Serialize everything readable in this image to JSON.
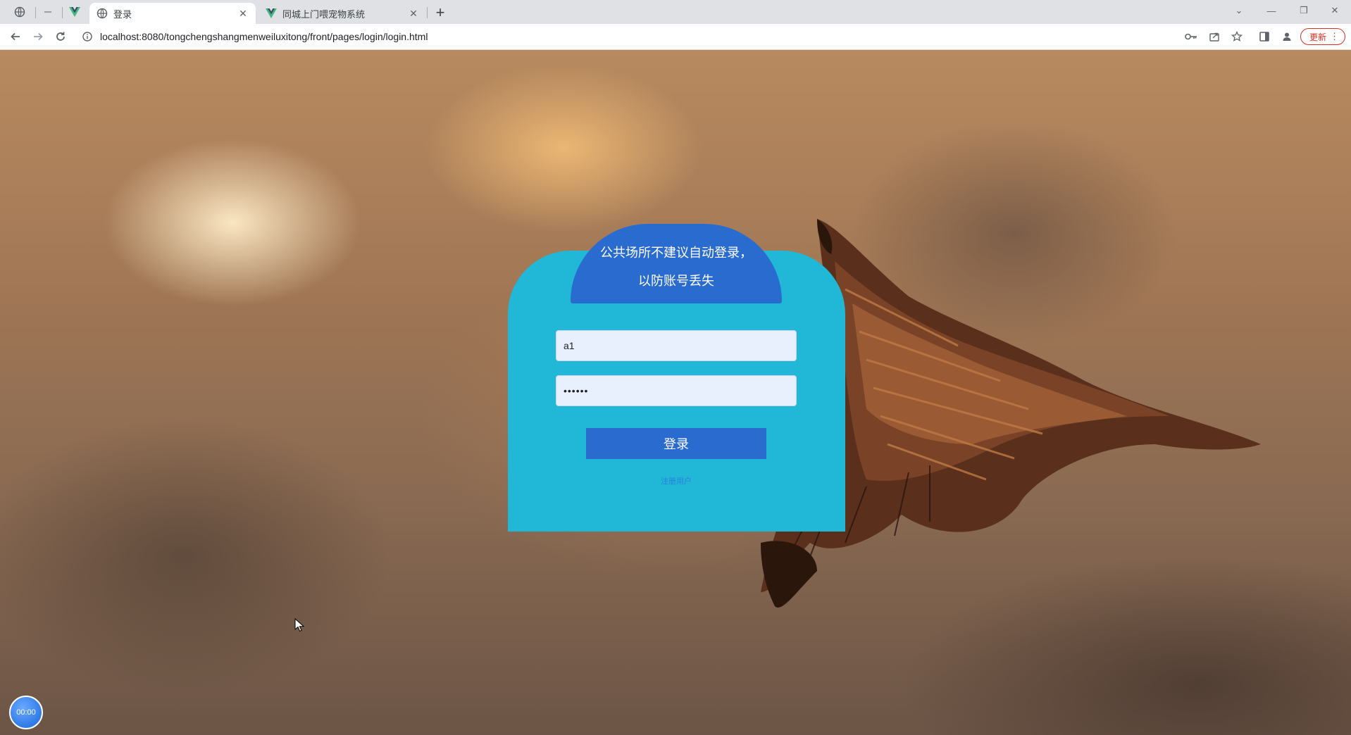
{
  "browser": {
    "tabs": [
      {
        "title": "登录",
        "active": true
      },
      {
        "title": "同城上门喂宠物系统",
        "active": false
      }
    ],
    "address_url": "localhost:8080/tongchengshangmenweiluxitong/front/pages/login/login.html",
    "update_label": "更新",
    "icons": {
      "back": "arrow-left-icon",
      "forward": "arrow-right-icon",
      "reload": "reload-icon",
      "info": "info-icon",
      "key": "key-icon",
      "share": "share-icon",
      "star": "star-icon",
      "sidepanel": "side-panel-icon",
      "profile": "profile-icon"
    }
  },
  "login": {
    "header_text": "公共场所不建议自动登录，以防账号丢失",
    "username_value": "a1",
    "password_value": "••••••",
    "submit_label": "登录",
    "register_link": "注册用户"
  },
  "floater_label": "00:00",
  "colors": {
    "panel": "#21b8d8",
    "header": "#2a6bd0",
    "button": "#2a6bd0",
    "input_bg": "#e8f0fe"
  }
}
